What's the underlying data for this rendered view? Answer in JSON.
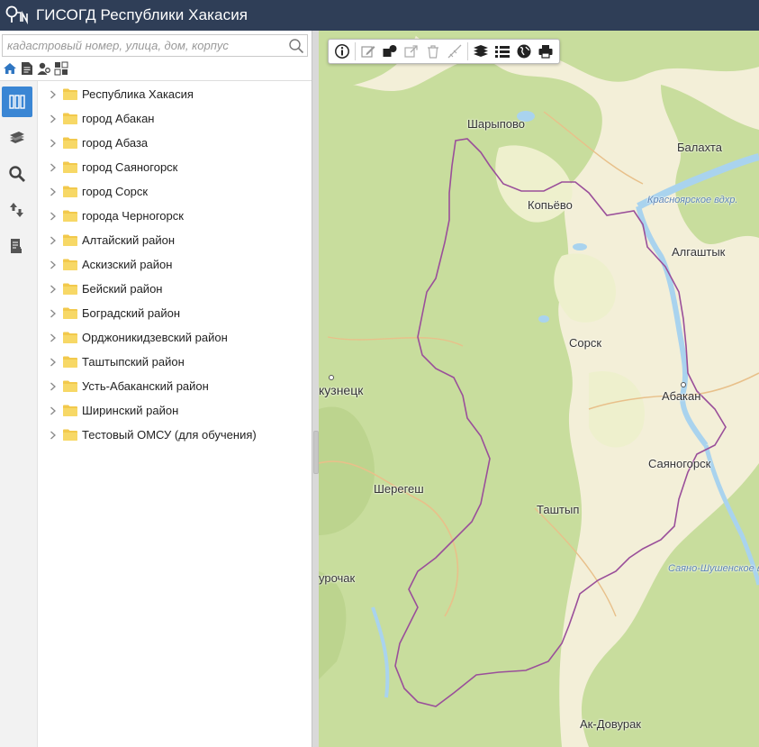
{
  "app": {
    "title": "ГИСОГД Республики Хакасия"
  },
  "search": {
    "placeholder": "кадастровый номер, улица, дом, корпус",
    "value": ""
  },
  "tree": {
    "items": [
      {
        "label": "Республика Хакасия"
      },
      {
        "label": "город Абакан"
      },
      {
        "label": "город Абаза"
      },
      {
        "label": "город Саяногорск"
      },
      {
        "label": "город Сорск"
      },
      {
        "label": "города Черногорск"
      },
      {
        "label": "Алтайский район"
      },
      {
        "label": "Аскизский район"
      },
      {
        "label": "Бейский район"
      },
      {
        "label": "Боградский район"
      },
      {
        "label": "Орджоникидзевский район"
      },
      {
        "label": "Таштыпский район"
      },
      {
        "label": "Усть-Абаканский район"
      },
      {
        "label": "Ширинский район"
      },
      {
        "label": "Тестовый ОМСУ (для обучения)"
      }
    ]
  },
  "map": {
    "labels": {
      "sharypovo": "Шарыпово",
      "kopyevo": "Копьёво",
      "balakhta": "Балахта",
      "krasnoyarsk_res": "Красноярское вдхр.",
      "algashtyk": "Алгаштык",
      "sorsk": "Сорск",
      "abakan": "Абакан",
      "novokuznetsk": "кузнецк",
      "sayanogorsk": "Саяногорск",
      "sheregesh": "Шерегеш",
      "tashtyp": "Таштып",
      "sayano_res": "Саяно-Шушенское в",
      "turochak": "урочак",
      "ak_dovurak": "Ак-Довурак"
    }
  },
  "colors": {
    "header": "#2f3e57",
    "accent": "#3a86d4",
    "forest": "#c5dc9a",
    "land": "#f3efd8",
    "water": "#a9d3ee",
    "border": "#9a4f9a"
  }
}
